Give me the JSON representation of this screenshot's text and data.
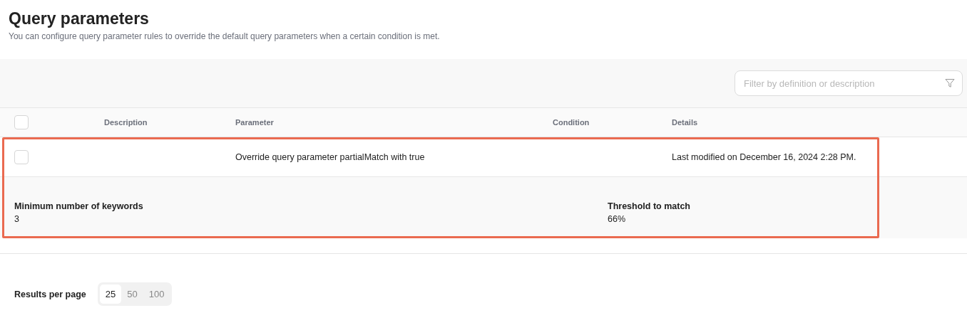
{
  "header": {
    "title": "Query parameters",
    "subtitle": "You can configure query parameter rules to override the default query parameters when a certain condition is met."
  },
  "filter": {
    "placeholder": "Filter by definition or description"
  },
  "table": {
    "select_all": {
      "checked": false
    },
    "columns": [
      "Description",
      "Parameter",
      "Condition",
      "Details"
    ],
    "rows": [
      {
        "checked": false,
        "description": "",
        "parameter": "Override query parameter partialMatch with true",
        "condition": "",
        "details": "Last modified on December 16, 2024 2:28 PM.",
        "highlighted": true,
        "expanded": true,
        "detail_fields": [
          {
            "label": "Minimum number of keywords",
            "value": "3"
          },
          {
            "label": "Threshold to match",
            "value": "66%"
          }
        ]
      }
    ]
  },
  "pagination": {
    "label": "Results per page",
    "options": [
      {
        "label": "25",
        "selected": true
      },
      {
        "label": "50",
        "selected": false
      },
      {
        "label": "100",
        "selected": false
      }
    ]
  }
}
